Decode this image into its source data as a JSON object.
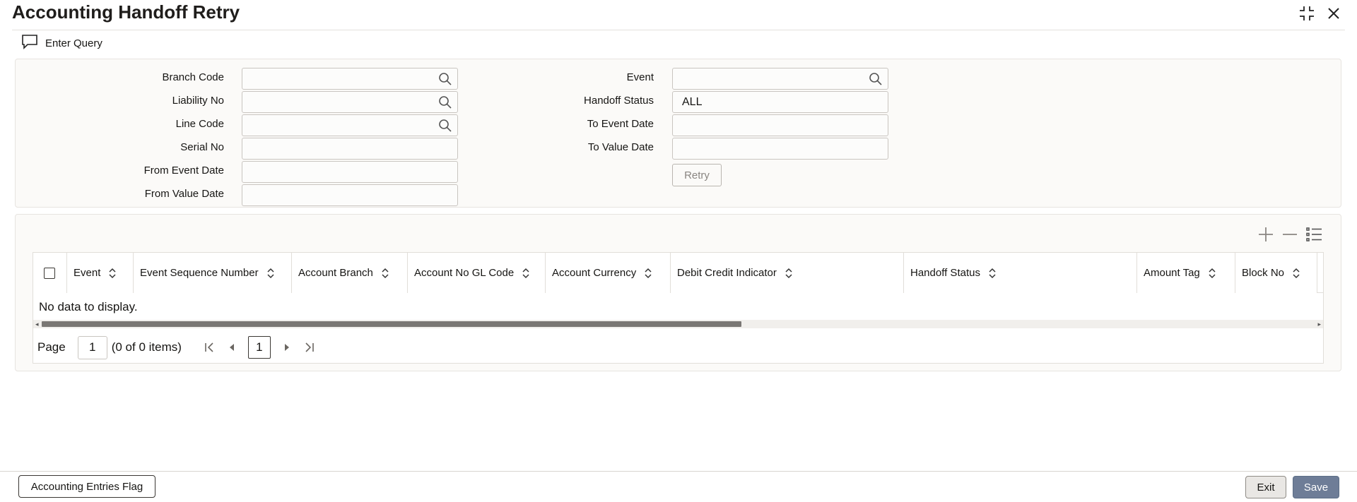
{
  "window": {
    "title": "Accounting Handoff Retry",
    "icons": [
      "collapse-icon",
      "close-icon"
    ]
  },
  "toolbar": {
    "enter_query_label": "Enter Query",
    "enter_query_icon": "comment-icon"
  },
  "query": {
    "branch_code_label": "Branch Code",
    "branch_code_value": "",
    "liability_no_label": "Liability No",
    "liability_no_value": "",
    "line_code_label": "Line Code",
    "line_code_value": "",
    "serial_no_label": "Serial No",
    "serial_no_value": "",
    "from_event_date_label": "From Event Date",
    "from_event_date_value": "",
    "from_value_date_label": "From Value Date",
    "from_value_date_value": "",
    "event_label": "Event",
    "event_value": "",
    "handoff_status_label": "Handoff Status",
    "handoff_status_value": "ALL",
    "to_event_date_label": "To Event Date",
    "to_event_date_value": "",
    "to_value_date_label": "To Value Date",
    "to_value_date_value": "",
    "retry_label": "Retry"
  },
  "grid": {
    "tools": [
      "add-icon",
      "remove-icon",
      "column-list-icon"
    ],
    "columns": [
      "Event",
      "Event Sequence Number",
      "Account Branch",
      "Account No GL Code",
      "Account Currency",
      "Debit Credit Indicator",
      "Handoff Status",
      "Amount Tag",
      "Block No"
    ],
    "empty_text": "No data to display.",
    "pager": {
      "page_label": "Page",
      "page_value": "1",
      "items_text": "(0 of 0 items)",
      "current_page": "1"
    }
  },
  "footer": {
    "accounting_entries_flag_label": "Accounting Entries Flag",
    "exit_label": "Exit",
    "save_label": "Save"
  },
  "colors": {
    "accent_save": "#6e7d97",
    "panel_bg": "#fbfaf8",
    "border": "#c9c5c0"
  }
}
